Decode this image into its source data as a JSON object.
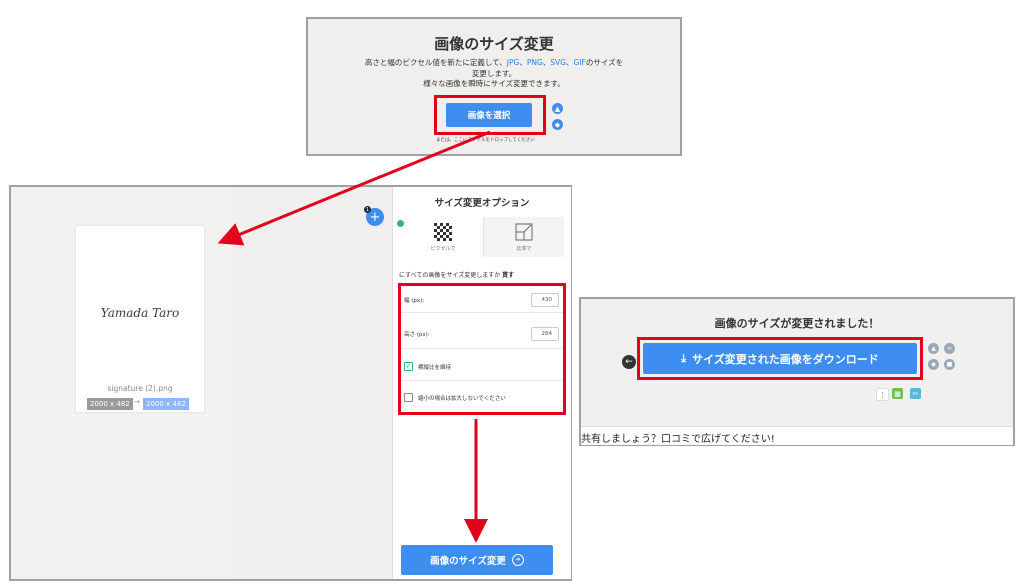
{
  "upload": {
    "title": "画像のサイズ変更",
    "line1_pre": "高さと幅のピクセル値を新たに定義して、",
    "formats": [
      "JPG",
      "PNG",
      "SVG",
      "GIF"
    ],
    "format_sep": "、",
    "line1_post": "のサイズを",
    "line2": "変更します。",
    "line3": "様々な画像を瞬時にサイズ変更できます。",
    "select_button": "画像を選択",
    "drop_note": "または、ここにファイルをドロップしてください"
  },
  "editor": {
    "signature_text": "Yamada Taro",
    "file_name": "signature (2).png",
    "dim_old": "2000 x 482",
    "dim_arrow": "→",
    "dim_new": "2000 x 482",
    "add_badge": "1",
    "add_symbol": "+",
    "options_title": "サイズ変更オプション",
    "tab_pixel": "ピクセルで",
    "tab_percent": "比率で",
    "resize_all": "にすべての画像をサイズ変更しますか",
    "resize_all_bold": "貫す",
    "width_label": "幅 (px):",
    "width_value": "430",
    "height_label": "高さ (px):",
    "height_value": "284",
    "keep_ratio_label": "横縦比を維持",
    "no_enlarge_label": "縮小の場合は拡大しないでください",
    "resize_button": "画像のサイズ変更",
    "resize_button_icon": "➔"
  },
  "done": {
    "title": "画像のサイズが変更されました！",
    "download_icon": "⤓",
    "download_button": "サイズ変更された画像をダウンロード",
    "back_symbol": "←",
    "more_symbol": "⋮",
    "share_text": "共有しましょう？口コミで広げてください!"
  },
  "colors": {
    "accent": "#3d8ef0",
    "highlight": "#e2001a",
    "panel_border": "#a0a0a0"
  }
}
